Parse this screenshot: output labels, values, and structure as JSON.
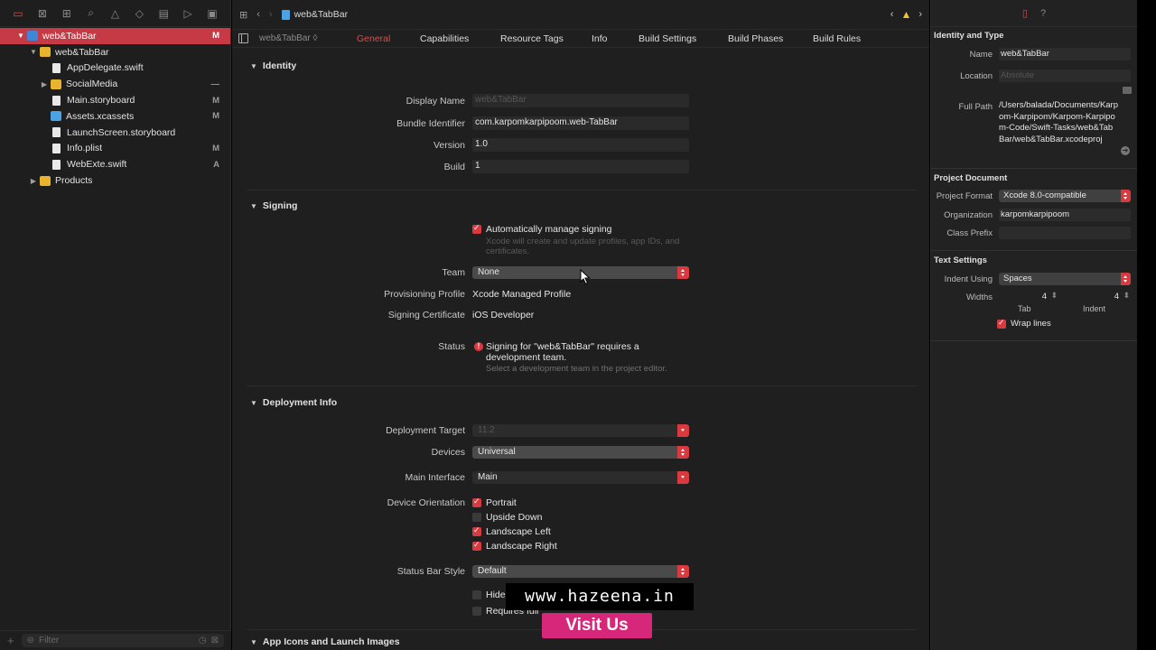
{
  "navigator": {
    "tree": [
      {
        "name": "web&TabBar",
        "badge": "M",
        "kind": "project",
        "indent": 0,
        "disclosure": "open",
        "selected": true
      },
      {
        "name": "web&TabBar",
        "badge": "",
        "kind": "folder",
        "indent": 1,
        "disclosure": "open"
      },
      {
        "name": "AppDelegate.swift",
        "badge": "",
        "kind": "file",
        "indent": 2
      },
      {
        "name": "SocialMedia",
        "badge": "—",
        "kind": "folder",
        "indent": 2,
        "disclosure": "closed"
      },
      {
        "name": "Main.storyboard",
        "badge": "M",
        "kind": "file",
        "indent": 2
      },
      {
        "name": "Assets.xcassets",
        "badge": "M",
        "kind": "folder-blue",
        "indent": 2
      },
      {
        "name": "LaunchScreen.storyboard",
        "badge": "",
        "kind": "file",
        "indent": 2
      },
      {
        "name": "Info.plist",
        "badge": "M",
        "kind": "file",
        "indent": 2
      },
      {
        "name": "WebExte.swift",
        "badge": "A",
        "kind": "file",
        "indent": 2
      },
      {
        "name": "Products",
        "badge": "",
        "kind": "folder",
        "indent": 1,
        "disclosure": "closed"
      }
    ],
    "filter_placeholder": "Filter"
  },
  "editor": {
    "jump_file": "web&TabBar",
    "target": "web&TabBar ◊",
    "tabs": [
      "General",
      "Capabilities",
      "Resource Tags",
      "Info",
      "Build Settings",
      "Build Phases",
      "Build Rules"
    ],
    "active_tab": "General",
    "identity": {
      "header": "Identity",
      "display_name_label": "Display Name",
      "display_name_placeholder": "web&TabBar",
      "bundle_label": "Bundle Identifier",
      "bundle_value": "com.karpomkarpipoom.web-TabBar",
      "version_label": "Version",
      "version_value": "1.0",
      "build_label": "Build",
      "build_value": "1"
    },
    "signing": {
      "header": "Signing",
      "auto_label": "Automatically manage signing",
      "auto_hint": "Xcode will create and update profiles, app IDs, and certificates.",
      "team_label": "Team",
      "team_value": "None",
      "profile_label": "Provisioning Profile",
      "profile_value": "Xcode Managed Profile",
      "cert_label": "Signing Certificate",
      "cert_value": "iOS Developer",
      "status_label": "Status",
      "status_message": "Signing for \"web&TabBar\" requires a development team.",
      "status_hint": "Select a development team in the project editor."
    },
    "deployment": {
      "header": "Deployment Info",
      "target_label": "Deployment Target",
      "target_value": "11.2",
      "devices_label": "Devices",
      "devices_value": "Universal",
      "interface_label": "Main Interface",
      "interface_value": "Main",
      "orientation_label": "Device Orientation",
      "orientations": [
        {
          "label": "Portrait",
          "checked": true
        },
        {
          "label": "Upside Down",
          "checked": false
        },
        {
          "label": "Landscape Left",
          "checked": true
        },
        {
          "label": "Landscape Right",
          "checked": true
        }
      ],
      "statusbar_label": "Status Bar Style",
      "statusbar_value": "Default",
      "hide_label": "Hide",
      "requires_label": "Requires full"
    },
    "app_icons_header": "App Icons and Launch Images"
  },
  "inspector": {
    "identity_header": "Identity and Type",
    "name_label": "Name",
    "name_value": "web&TabBar",
    "location_label": "Location",
    "location_value": "Absolute",
    "fullpath_label": "Full Path",
    "fullpath_value": "/Users/balada/Documents/Karpom-Karpipom/Karpom-Karpipom-Code/Swift-Tasks/web&TabBar/web&TabBar.xcodeproj",
    "project_doc_header": "Project Document",
    "format_label": "Project Format",
    "format_value": "Xcode 8.0-compatible",
    "org_label": "Organization",
    "org_value": "karpomkarpipoom",
    "prefix_label": "Class Prefix",
    "prefix_value": "",
    "text_settings_header": "Text Settings",
    "indent_using_label": "Indent Using",
    "indent_using_value": "Spaces",
    "widths_label": "Widths",
    "tab_width": "4",
    "indent_width": "4",
    "tab_caption": "Tab",
    "indent_caption": "Indent",
    "wrap_label": "Wrap lines"
  },
  "watermark": {
    "site": "www.hazeena.in",
    "cta": "Visit Us"
  },
  "colors": {
    "accent": "#d93a3f",
    "selection": "#c53a45",
    "background": "#1f1f1f"
  }
}
